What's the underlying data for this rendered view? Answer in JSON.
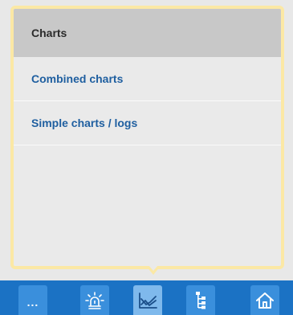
{
  "menu": {
    "header": "Charts",
    "items": [
      {
        "label": "Combined charts"
      },
      {
        "label": "Simple charts / logs"
      }
    ]
  },
  "toolbar": {
    "buttons": [
      {
        "name": "more",
        "label": "...",
        "icon": "more-dots-icon"
      },
      {
        "name": "alarms",
        "icon": "alarm-light-icon"
      },
      {
        "name": "charts",
        "icon": "line-chart-icon",
        "active": true
      },
      {
        "name": "tree",
        "icon": "tree-structure-icon"
      },
      {
        "name": "home",
        "icon": "home-icon"
      }
    ]
  },
  "colors": {
    "popup_border": "#fbe8a5",
    "header_bg": "#c8c8c8",
    "link_text": "#1f5fa0",
    "toolbar_bg": "#1b72c4",
    "button_bg": "#3a8fdc",
    "button_active_bg": "#7fb9ec"
  }
}
